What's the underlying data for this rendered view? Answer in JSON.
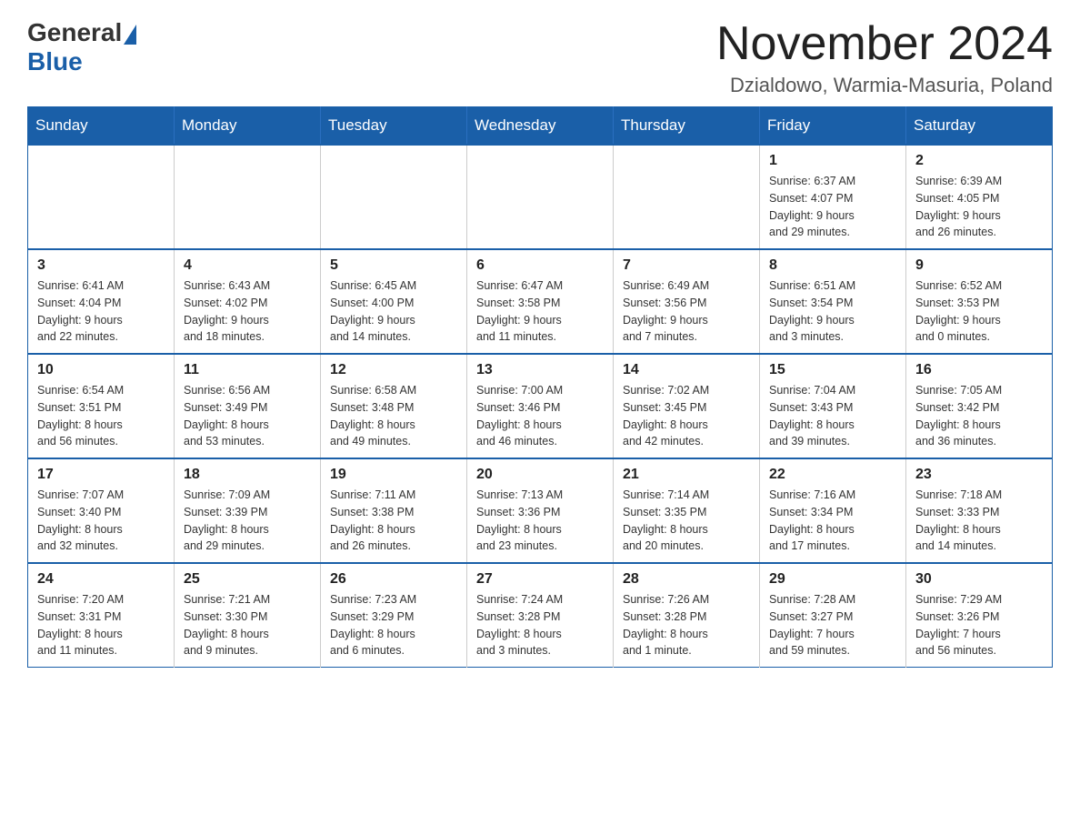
{
  "logo": {
    "general": "General",
    "blue": "Blue"
  },
  "title": "November 2024",
  "location": "Dzialdowo, Warmia-Masuria, Poland",
  "weekdays": [
    "Sunday",
    "Monday",
    "Tuesday",
    "Wednesday",
    "Thursday",
    "Friday",
    "Saturday"
  ],
  "weeks": [
    [
      {
        "day": "",
        "info": ""
      },
      {
        "day": "",
        "info": ""
      },
      {
        "day": "",
        "info": ""
      },
      {
        "day": "",
        "info": ""
      },
      {
        "day": "",
        "info": ""
      },
      {
        "day": "1",
        "info": "Sunrise: 6:37 AM\nSunset: 4:07 PM\nDaylight: 9 hours\nand 29 minutes."
      },
      {
        "day": "2",
        "info": "Sunrise: 6:39 AM\nSunset: 4:05 PM\nDaylight: 9 hours\nand 26 minutes."
      }
    ],
    [
      {
        "day": "3",
        "info": "Sunrise: 6:41 AM\nSunset: 4:04 PM\nDaylight: 9 hours\nand 22 minutes."
      },
      {
        "day": "4",
        "info": "Sunrise: 6:43 AM\nSunset: 4:02 PM\nDaylight: 9 hours\nand 18 minutes."
      },
      {
        "day": "5",
        "info": "Sunrise: 6:45 AM\nSunset: 4:00 PM\nDaylight: 9 hours\nand 14 minutes."
      },
      {
        "day": "6",
        "info": "Sunrise: 6:47 AM\nSunset: 3:58 PM\nDaylight: 9 hours\nand 11 minutes."
      },
      {
        "day": "7",
        "info": "Sunrise: 6:49 AM\nSunset: 3:56 PM\nDaylight: 9 hours\nand 7 minutes."
      },
      {
        "day": "8",
        "info": "Sunrise: 6:51 AM\nSunset: 3:54 PM\nDaylight: 9 hours\nand 3 minutes."
      },
      {
        "day": "9",
        "info": "Sunrise: 6:52 AM\nSunset: 3:53 PM\nDaylight: 9 hours\nand 0 minutes."
      }
    ],
    [
      {
        "day": "10",
        "info": "Sunrise: 6:54 AM\nSunset: 3:51 PM\nDaylight: 8 hours\nand 56 minutes."
      },
      {
        "day": "11",
        "info": "Sunrise: 6:56 AM\nSunset: 3:49 PM\nDaylight: 8 hours\nand 53 minutes."
      },
      {
        "day": "12",
        "info": "Sunrise: 6:58 AM\nSunset: 3:48 PM\nDaylight: 8 hours\nand 49 minutes."
      },
      {
        "day": "13",
        "info": "Sunrise: 7:00 AM\nSunset: 3:46 PM\nDaylight: 8 hours\nand 46 minutes."
      },
      {
        "day": "14",
        "info": "Sunrise: 7:02 AM\nSunset: 3:45 PM\nDaylight: 8 hours\nand 42 minutes."
      },
      {
        "day": "15",
        "info": "Sunrise: 7:04 AM\nSunset: 3:43 PM\nDaylight: 8 hours\nand 39 minutes."
      },
      {
        "day": "16",
        "info": "Sunrise: 7:05 AM\nSunset: 3:42 PM\nDaylight: 8 hours\nand 36 minutes."
      }
    ],
    [
      {
        "day": "17",
        "info": "Sunrise: 7:07 AM\nSunset: 3:40 PM\nDaylight: 8 hours\nand 32 minutes."
      },
      {
        "day": "18",
        "info": "Sunrise: 7:09 AM\nSunset: 3:39 PM\nDaylight: 8 hours\nand 29 minutes."
      },
      {
        "day": "19",
        "info": "Sunrise: 7:11 AM\nSunset: 3:38 PM\nDaylight: 8 hours\nand 26 minutes."
      },
      {
        "day": "20",
        "info": "Sunrise: 7:13 AM\nSunset: 3:36 PM\nDaylight: 8 hours\nand 23 minutes."
      },
      {
        "day": "21",
        "info": "Sunrise: 7:14 AM\nSunset: 3:35 PM\nDaylight: 8 hours\nand 20 minutes."
      },
      {
        "day": "22",
        "info": "Sunrise: 7:16 AM\nSunset: 3:34 PM\nDaylight: 8 hours\nand 17 minutes."
      },
      {
        "day": "23",
        "info": "Sunrise: 7:18 AM\nSunset: 3:33 PM\nDaylight: 8 hours\nand 14 minutes."
      }
    ],
    [
      {
        "day": "24",
        "info": "Sunrise: 7:20 AM\nSunset: 3:31 PM\nDaylight: 8 hours\nand 11 minutes."
      },
      {
        "day": "25",
        "info": "Sunrise: 7:21 AM\nSunset: 3:30 PM\nDaylight: 8 hours\nand 9 minutes."
      },
      {
        "day": "26",
        "info": "Sunrise: 7:23 AM\nSunset: 3:29 PM\nDaylight: 8 hours\nand 6 minutes."
      },
      {
        "day": "27",
        "info": "Sunrise: 7:24 AM\nSunset: 3:28 PM\nDaylight: 8 hours\nand 3 minutes."
      },
      {
        "day": "28",
        "info": "Sunrise: 7:26 AM\nSunset: 3:28 PM\nDaylight: 8 hours\nand 1 minute."
      },
      {
        "day": "29",
        "info": "Sunrise: 7:28 AM\nSunset: 3:27 PM\nDaylight: 7 hours\nand 59 minutes."
      },
      {
        "day": "30",
        "info": "Sunrise: 7:29 AM\nSunset: 3:26 PM\nDaylight: 7 hours\nand 56 minutes."
      }
    ]
  ]
}
